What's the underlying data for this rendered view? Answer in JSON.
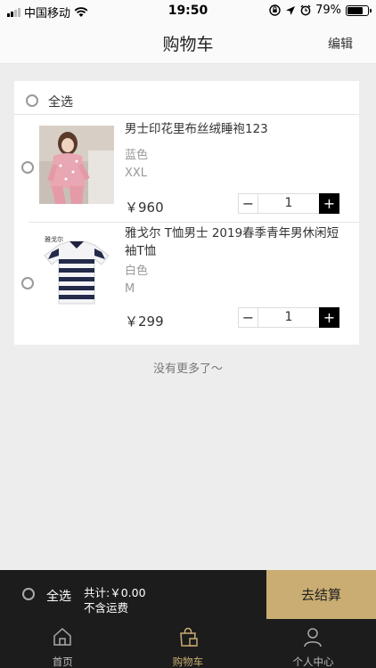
{
  "status_bar": {
    "carrier": "中国移动",
    "time": "19:50",
    "battery": "79%",
    "battery_level": 0.79
  },
  "header": {
    "title": "购物车",
    "edit_label": "编辑"
  },
  "cart": {
    "select_all_label": "全选",
    "items": [
      {
        "name": "男士印花里布丝绒睡袍123",
        "color": "蓝色",
        "size": "XXL",
        "price": "￥960",
        "quantity": "1"
      },
      {
        "name": "雅戈尔 T恤男士 2019春季青年男休闲短袖T恤",
        "color": "白色",
        "size": "M",
        "price": "￥299",
        "quantity": "1"
      }
    ],
    "no_more_text": "没有更多了～"
  },
  "checkout": {
    "select_all_label": "全选",
    "total_text": "共计:￥0.00",
    "shipping_text": "不含运费",
    "button_label": "去结算"
  },
  "tab_bar": {
    "tabs": [
      {
        "label": "首页",
        "icon": "home-icon"
      },
      {
        "label": "购物车",
        "icon": "shopping-bag-icon"
      },
      {
        "label": "个人中心",
        "icon": "user-icon"
      }
    ],
    "active_index": 1
  },
  "colors": {
    "accent_gold": "#c9ad72",
    "dark_bar": "#1c1c1c",
    "background": "#ededed"
  }
}
